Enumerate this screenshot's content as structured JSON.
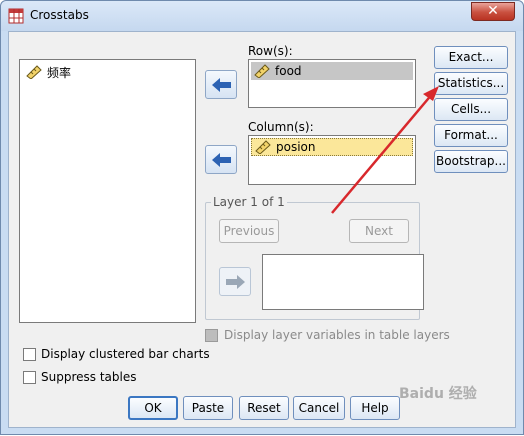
{
  "window": {
    "title": "Crosstabs",
    "close_symbol": "✕"
  },
  "source_list": {
    "items": [
      {
        "label": "频率"
      }
    ]
  },
  "rows": {
    "label": "Row(s):",
    "items": [
      {
        "label": "food"
      }
    ]
  },
  "columns": {
    "label": "Column(s):",
    "items": [
      {
        "label": "posion"
      }
    ]
  },
  "layer": {
    "legend": "Layer 1 of 1",
    "previous_label": "Previous",
    "next_label": "Next",
    "display_layer_label": "Display layer variables in table layers"
  },
  "side_buttons": {
    "exact": "Exact...",
    "statistics": "Statistics...",
    "cells": "Cells...",
    "format": "Format...",
    "bootstrap": "Bootstrap..."
  },
  "checkboxes": {
    "clustered": "Display clustered bar charts",
    "suppress": "Suppress tables"
  },
  "bottom_buttons": {
    "ok": "OK",
    "paste": "Paste",
    "reset": "Reset",
    "cancel": "Cancel",
    "help": "Help"
  },
  "watermark": {
    "text": "Baidu 经验"
  },
  "colors": {
    "selected_row": "#c6c6c6",
    "selected_column": "#fbe79a",
    "annotation_arrow": "#d8282c",
    "ok_border": "#3b77c2"
  },
  "icons": {
    "variable": "ruler-icon",
    "move": "arrow-left-icon",
    "layer_move": "arrow-right-icon",
    "app": "crosstabs-app-icon"
  }
}
